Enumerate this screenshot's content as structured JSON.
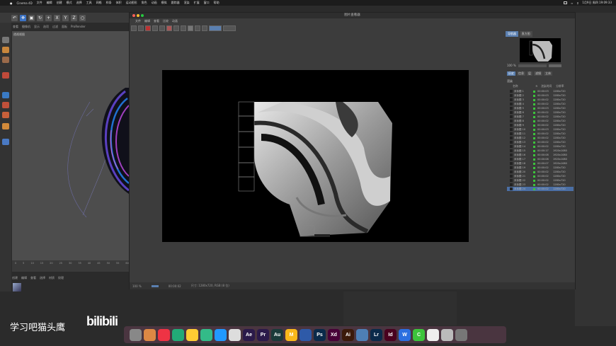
{
  "menubar": {
    "items": [
      "Cinema 4D",
      "文件",
      "编辑",
      "创建",
      "模式",
      "选择",
      "工具",
      "网格",
      "样条",
      "体积",
      "运动图形",
      "角色",
      "动画",
      "模拟",
      "跟踪器",
      "渲染",
      "扩展",
      "窗口",
      "帮助"
    ],
    "clock": "1月9日 周四 19:09:33"
  },
  "c4d": {
    "toolbar_xyz": [
      "X",
      "Y",
      "Z"
    ],
    "viewport_menu": [
      "查看",
      "摄像机",
      "显示",
      "选项",
      "过滤",
      "面板",
      "ProRender"
    ],
    "viewport_label": "透视视图",
    "timeline_ticks": [
      "0",
      "5",
      "10",
      "15",
      "20",
      "25",
      "30",
      "35",
      "40",
      "45",
      "50",
      "55",
      "60"
    ],
    "material_menu": [
      "创建",
      "编辑",
      "查看",
      "选择",
      "材质",
      "纹理"
    ]
  },
  "picture_viewer": {
    "title": "图片查看器",
    "menu": [
      "文件",
      "编辑",
      "查看",
      "比较",
      "动画"
    ],
    "status": {
      "zoom": "100 %",
      "time": "00:00:02",
      "info": "尺寸: 1280x720, RGB (8 位)"
    },
    "side_tabs": [
      "导航器",
      "直方图"
    ],
    "zoom_value": "100 %",
    "info_tabs": [
      "历史",
      "信息",
      "层",
      "滤镜",
      "立体"
    ],
    "history_label": "渲染",
    "history_columns": [
      "名称",
      "R",
      "渲染时间",
      "分辨率"
    ],
    "history_rows": [
      {
        "name": "未标题 1",
        "time": "00:00:03",
        "res": "1280x720"
      },
      {
        "name": "未标题 2",
        "time": "00:00:03",
        "res": "1280x720"
      },
      {
        "name": "未标题 3",
        "time": "00:00:02",
        "res": "1280x720"
      },
      {
        "name": "未标题 4",
        "time": "00:00:02",
        "res": "1280x720"
      },
      {
        "name": "未标题 5",
        "time": "00:00:03",
        "res": "1280x720"
      },
      {
        "name": "未标题 6",
        "time": "00:00:02",
        "res": "1280x720"
      },
      {
        "name": "未标题 7",
        "time": "00:00:02",
        "res": "1280x720"
      },
      {
        "name": "未标题 8",
        "time": "00:00:02",
        "res": "1280x720"
      },
      {
        "name": "未标题 9",
        "time": "00:00:02",
        "res": "1280x720"
      },
      {
        "name": "未标题 10",
        "time": "00:00:03",
        "res": "1280x720"
      },
      {
        "name": "未标题 11",
        "time": "00:00:02",
        "res": "1280x720"
      },
      {
        "name": "未标题 12",
        "time": "00:00:02",
        "res": "1280x720"
      },
      {
        "name": "未标题 13",
        "time": "00:00:02",
        "res": "1280x720"
      },
      {
        "name": "未标题 14",
        "time": "00:00:02",
        "res": "1280x720"
      },
      {
        "name": "未标题 15",
        "time": "00:00:17",
        "res": "1920x1080"
      },
      {
        "name": "未标题 16",
        "time": "00:00:08",
        "res": "1920x1080"
      },
      {
        "name": "未标题 17",
        "time": "00:00:08",
        "res": "1920x1080"
      },
      {
        "name": "未标题 18",
        "time": "00:00:07",
        "res": "1920x1080"
      },
      {
        "name": "未标题 19",
        "time": "00:00:02",
        "res": "1280x720"
      },
      {
        "name": "未标题 20",
        "time": "00:00:02",
        "res": "1280x720"
      },
      {
        "name": "未标题 21",
        "time": "00:00:02",
        "res": "1280x720"
      },
      {
        "name": "未标题 22",
        "time": "00:00:02",
        "res": "1280x720"
      },
      {
        "name": "未标题 23",
        "time": "00:00:02",
        "res": "1280x720"
      },
      {
        "name": "未标题 24",
        "time": "00:00:02",
        "res": "1280x720"
      }
    ]
  },
  "dock": [
    "",
    "",
    "",
    "",
    "",
    "",
    "",
    "",
    "Ae",
    "Pr",
    "Au",
    "M",
    "",
    "Ps",
    "Xd",
    "Ai",
    "",
    "Lr",
    "Id",
    "W",
    "C",
    "",
    "",
    ""
  ],
  "watermark": "学习吧猫头鹰",
  "bilibili": "bilibili",
  "colors": {
    "accent": "#4b6fa5",
    "dock_bg": "#4a3540",
    "render_bg": "#000000"
  }
}
